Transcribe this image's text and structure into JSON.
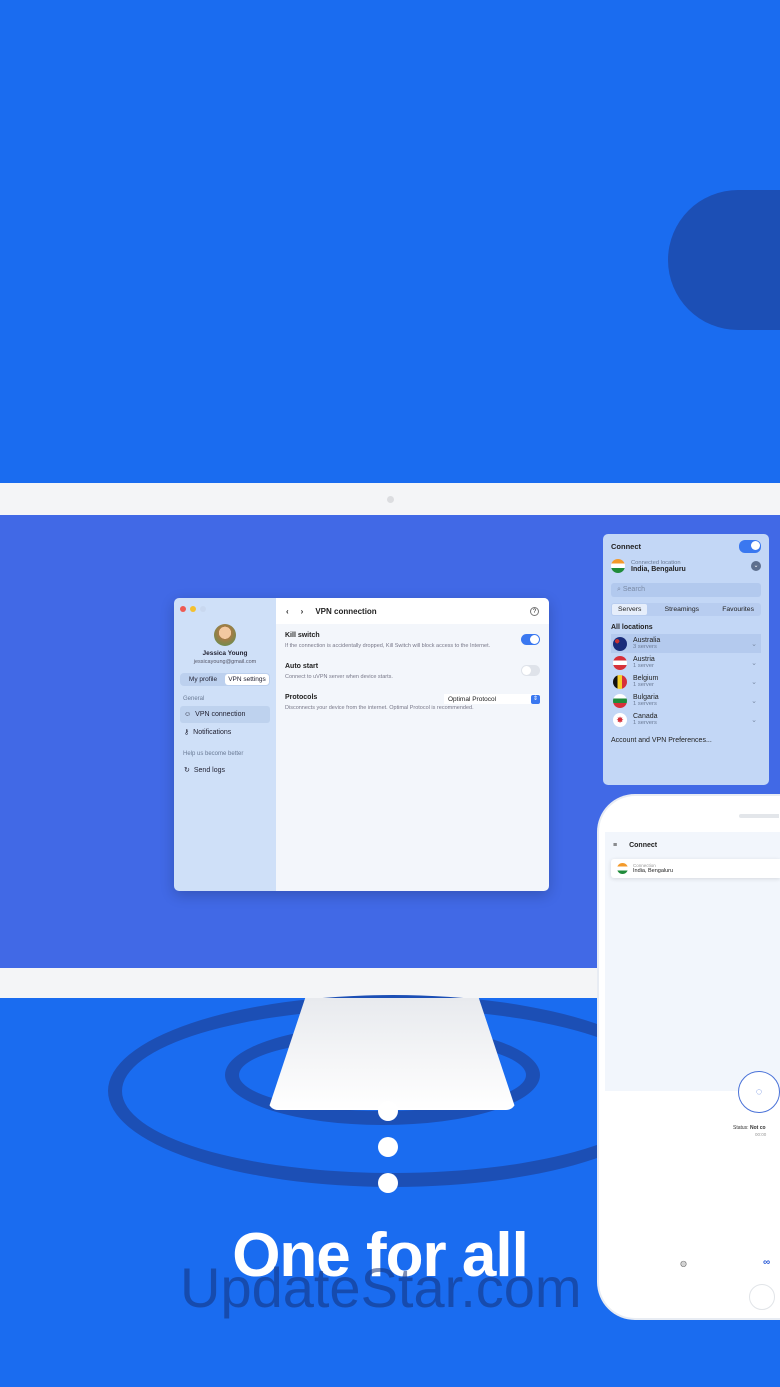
{
  "headline": "One for all",
  "watermark": "UpdateStar.com",
  "desktop_window": {
    "user_name": "Jessica Young",
    "user_email": "jessicayoung@gmail.com",
    "tabs": [
      "My profile",
      "VPN settings"
    ],
    "section_general": "General",
    "nav": [
      {
        "label": "VPN connection",
        "icon": "user-icon"
      },
      {
        "label": "Notifications",
        "icon": "key-icon"
      }
    ],
    "section_help": "Help us become better",
    "send_logs": "Send logs",
    "header_title": "VPN connection",
    "settings": [
      {
        "title": "Kill switch",
        "desc": "If the connection is accidentally dropped, Kill Switch will block access to the Internet.",
        "enabled": true
      },
      {
        "title": "Auto start",
        "desc": "Connect to uVPN server when device starts.",
        "enabled": false
      }
    ],
    "protocols": {
      "title": "Protocols",
      "value": "Optimal Protocol",
      "desc": "Disconnects your device from the internet. Optimal Protocol is recommended."
    }
  },
  "popover": {
    "connect": "Connect",
    "connected": true,
    "location_label": "Connected location",
    "location": "India, Bengaluru",
    "search_placeholder": "Search",
    "tabs": [
      "Servers",
      "Streamings",
      "Favourites"
    ],
    "all_locations": "All locations",
    "countries": [
      {
        "name": "Australia",
        "servers": "3 servers"
      },
      {
        "name": "Austria",
        "servers": "1 server"
      },
      {
        "name": "Belgium",
        "servers": "1 server"
      },
      {
        "name": "Bulgaria",
        "servers": "1 servers"
      },
      {
        "name": "Canada",
        "servers": "1 servers"
      }
    ],
    "footer": "Account and VPN Preferences..."
  },
  "phone": {
    "title": "Connect",
    "conn_label": "Connection",
    "location": "India, Bengaluru",
    "status_label": "Status:",
    "status_value": "Not co",
    "timer": "00:00"
  }
}
